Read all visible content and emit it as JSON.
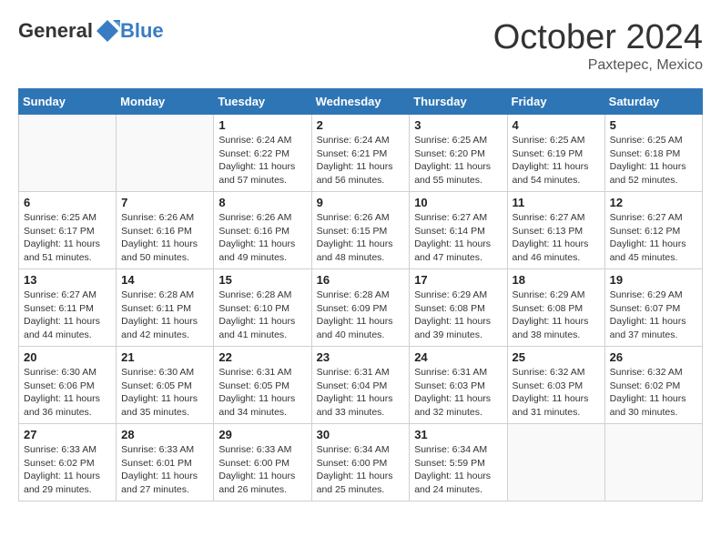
{
  "header": {
    "logo_general": "General",
    "logo_blue": "Blue",
    "month": "October 2024",
    "location": "Paxtepec, Mexico"
  },
  "days_of_week": [
    "Sunday",
    "Monday",
    "Tuesday",
    "Wednesday",
    "Thursday",
    "Friday",
    "Saturday"
  ],
  "weeks": [
    [
      {
        "date": "",
        "sunrise": "",
        "sunset": "",
        "daylight": ""
      },
      {
        "date": "",
        "sunrise": "",
        "sunset": "",
        "daylight": ""
      },
      {
        "date": "1",
        "sunrise": "Sunrise: 6:24 AM",
        "sunset": "Sunset: 6:22 PM",
        "daylight": "Daylight: 11 hours and 57 minutes."
      },
      {
        "date": "2",
        "sunrise": "Sunrise: 6:24 AM",
        "sunset": "Sunset: 6:21 PM",
        "daylight": "Daylight: 11 hours and 56 minutes."
      },
      {
        "date": "3",
        "sunrise": "Sunrise: 6:25 AM",
        "sunset": "Sunset: 6:20 PM",
        "daylight": "Daylight: 11 hours and 55 minutes."
      },
      {
        "date": "4",
        "sunrise": "Sunrise: 6:25 AM",
        "sunset": "Sunset: 6:19 PM",
        "daylight": "Daylight: 11 hours and 54 minutes."
      },
      {
        "date": "5",
        "sunrise": "Sunrise: 6:25 AM",
        "sunset": "Sunset: 6:18 PM",
        "daylight": "Daylight: 11 hours and 52 minutes."
      }
    ],
    [
      {
        "date": "6",
        "sunrise": "Sunrise: 6:25 AM",
        "sunset": "Sunset: 6:17 PM",
        "daylight": "Daylight: 11 hours and 51 minutes."
      },
      {
        "date": "7",
        "sunrise": "Sunrise: 6:26 AM",
        "sunset": "Sunset: 6:16 PM",
        "daylight": "Daylight: 11 hours and 50 minutes."
      },
      {
        "date": "8",
        "sunrise": "Sunrise: 6:26 AM",
        "sunset": "Sunset: 6:16 PM",
        "daylight": "Daylight: 11 hours and 49 minutes."
      },
      {
        "date": "9",
        "sunrise": "Sunrise: 6:26 AM",
        "sunset": "Sunset: 6:15 PM",
        "daylight": "Daylight: 11 hours and 48 minutes."
      },
      {
        "date": "10",
        "sunrise": "Sunrise: 6:27 AM",
        "sunset": "Sunset: 6:14 PM",
        "daylight": "Daylight: 11 hours and 47 minutes."
      },
      {
        "date": "11",
        "sunrise": "Sunrise: 6:27 AM",
        "sunset": "Sunset: 6:13 PM",
        "daylight": "Daylight: 11 hours and 46 minutes."
      },
      {
        "date": "12",
        "sunrise": "Sunrise: 6:27 AM",
        "sunset": "Sunset: 6:12 PM",
        "daylight": "Daylight: 11 hours and 45 minutes."
      }
    ],
    [
      {
        "date": "13",
        "sunrise": "Sunrise: 6:27 AM",
        "sunset": "Sunset: 6:11 PM",
        "daylight": "Daylight: 11 hours and 44 minutes."
      },
      {
        "date": "14",
        "sunrise": "Sunrise: 6:28 AM",
        "sunset": "Sunset: 6:11 PM",
        "daylight": "Daylight: 11 hours and 42 minutes."
      },
      {
        "date": "15",
        "sunrise": "Sunrise: 6:28 AM",
        "sunset": "Sunset: 6:10 PM",
        "daylight": "Daylight: 11 hours and 41 minutes."
      },
      {
        "date": "16",
        "sunrise": "Sunrise: 6:28 AM",
        "sunset": "Sunset: 6:09 PM",
        "daylight": "Daylight: 11 hours and 40 minutes."
      },
      {
        "date": "17",
        "sunrise": "Sunrise: 6:29 AM",
        "sunset": "Sunset: 6:08 PM",
        "daylight": "Daylight: 11 hours and 39 minutes."
      },
      {
        "date": "18",
        "sunrise": "Sunrise: 6:29 AM",
        "sunset": "Sunset: 6:08 PM",
        "daylight": "Daylight: 11 hours and 38 minutes."
      },
      {
        "date": "19",
        "sunrise": "Sunrise: 6:29 AM",
        "sunset": "Sunset: 6:07 PM",
        "daylight": "Daylight: 11 hours and 37 minutes."
      }
    ],
    [
      {
        "date": "20",
        "sunrise": "Sunrise: 6:30 AM",
        "sunset": "Sunset: 6:06 PM",
        "daylight": "Daylight: 11 hours and 36 minutes."
      },
      {
        "date": "21",
        "sunrise": "Sunrise: 6:30 AM",
        "sunset": "Sunset: 6:05 PM",
        "daylight": "Daylight: 11 hours and 35 minutes."
      },
      {
        "date": "22",
        "sunrise": "Sunrise: 6:31 AM",
        "sunset": "Sunset: 6:05 PM",
        "daylight": "Daylight: 11 hours and 34 minutes."
      },
      {
        "date": "23",
        "sunrise": "Sunrise: 6:31 AM",
        "sunset": "Sunset: 6:04 PM",
        "daylight": "Daylight: 11 hours and 33 minutes."
      },
      {
        "date": "24",
        "sunrise": "Sunrise: 6:31 AM",
        "sunset": "Sunset: 6:03 PM",
        "daylight": "Daylight: 11 hours and 32 minutes."
      },
      {
        "date": "25",
        "sunrise": "Sunrise: 6:32 AM",
        "sunset": "Sunset: 6:03 PM",
        "daylight": "Daylight: 11 hours and 31 minutes."
      },
      {
        "date": "26",
        "sunrise": "Sunrise: 6:32 AM",
        "sunset": "Sunset: 6:02 PM",
        "daylight": "Daylight: 11 hours and 30 minutes."
      }
    ],
    [
      {
        "date": "27",
        "sunrise": "Sunrise: 6:33 AM",
        "sunset": "Sunset: 6:02 PM",
        "daylight": "Daylight: 11 hours and 29 minutes."
      },
      {
        "date": "28",
        "sunrise": "Sunrise: 6:33 AM",
        "sunset": "Sunset: 6:01 PM",
        "daylight": "Daylight: 11 hours and 27 minutes."
      },
      {
        "date": "29",
        "sunrise": "Sunrise: 6:33 AM",
        "sunset": "Sunset: 6:00 PM",
        "daylight": "Daylight: 11 hours and 26 minutes."
      },
      {
        "date": "30",
        "sunrise": "Sunrise: 6:34 AM",
        "sunset": "Sunset: 6:00 PM",
        "daylight": "Daylight: 11 hours and 25 minutes."
      },
      {
        "date": "31",
        "sunrise": "Sunrise: 6:34 AM",
        "sunset": "Sunset: 5:59 PM",
        "daylight": "Daylight: 11 hours and 24 minutes."
      },
      {
        "date": "",
        "sunrise": "",
        "sunset": "",
        "daylight": ""
      },
      {
        "date": "",
        "sunrise": "",
        "sunset": "",
        "daylight": ""
      }
    ]
  ]
}
